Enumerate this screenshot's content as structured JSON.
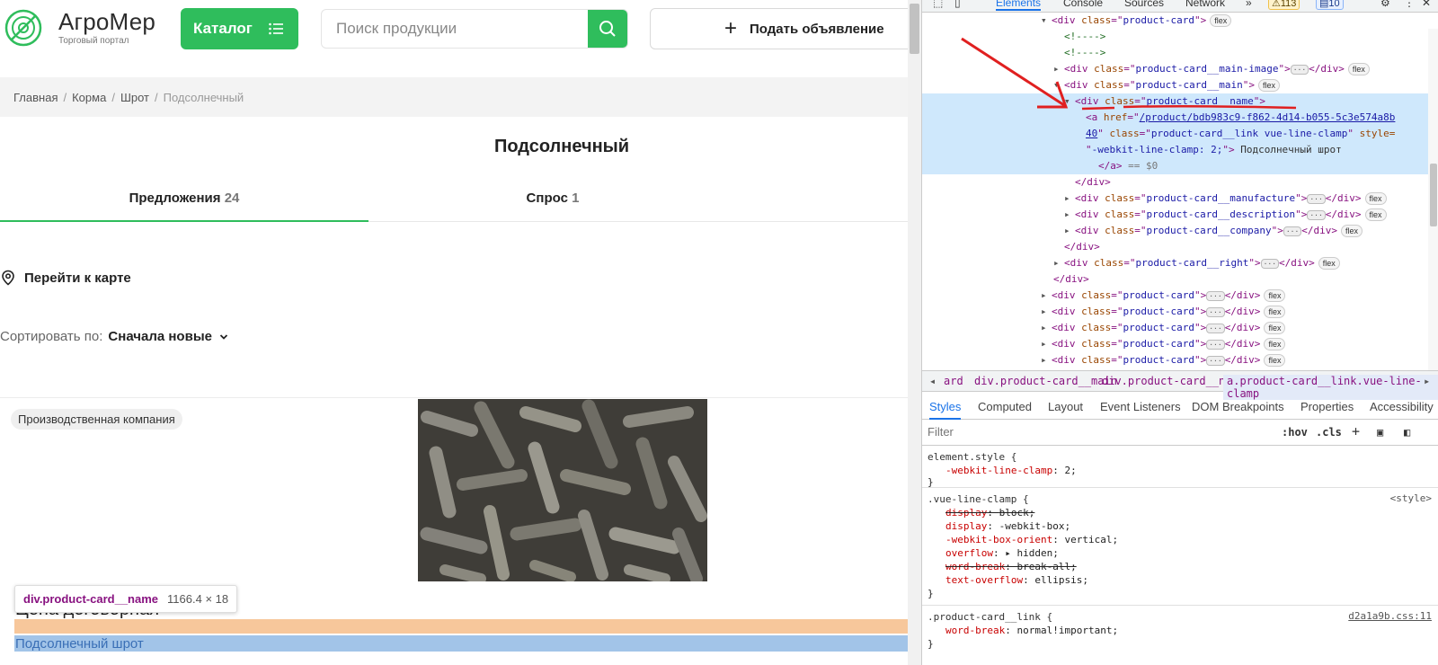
{
  "site": {
    "logo_name": "АгроМер",
    "logo_sub": "Торговый портал",
    "catalog_label": "Каталог",
    "search_placeholder": "Поиск продукции",
    "post_ad_label": "Подать объявление",
    "breadcrumbs": [
      "Главная",
      "Корма",
      "Шрот",
      "Подсолнечный"
    ],
    "page_title": "Подсолнечный",
    "tabs": [
      {
        "label": "Предложения",
        "count": "24"
      },
      {
        "label": "Спрос",
        "count": "1"
      }
    ],
    "map_link": "Перейти к карте",
    "sort_label": "Сортировать по:",
    "sort_value": "Сначала новые",
    "card": {
      "company_type": "Производственная компания",
      "price": "Цена договорная",
      "product_name": "Подсолнечный шрот"
    },
    "tooltip": {
      "selector": "div.product-card__name",
      "size": "1166.4 × 18"
    },
    "accent_color": "#2fbd5c"
  },
  "devtools": {
    "tabs": [
      "Elements",
      "Console",
      "Sources",
      "Network"
    ],
    "warn_count": "113",
    "info_count": "10",
    "dom_lines": [
      {
        "text_tag": "<div ",
        "attr": "class",
        "val": "product-card",
        "end": ">",
        "badge": "flex"
      },
      {
        "comment": "<!---->"
      },
      {
        "comment": "<!---->"
      },
      {
        "text_tag": "<div ",
        "attr": "class",
        "val": "product-card__main-image",
        "end": ">",
        "collapsed": "</div>",
        "badge": "flex"
      },
      {
        "text_tag": "<div ",
        "attr": "class",
        "val": "product-card__main",
        "end": ">",
        "badge": "flex"
      },
      {
        "text_tag": "<div ",
        "attr": "class",
        "val": "product-card__name",
        "end": ">"
      },
      {
        "a_href": "/product/bdb983c9-f862-4d14-b055-5c3e574a8b",
        "a_class": "product-card__link vue-line-clamp",
        "a_style_attr": "style=",
        "a_style": "-webkit-line-clamp: 2;",
        "a_text": "Подсолнечный шрот",
        "href_tail": "40",
        "a_close": "</a>",
        "eq": "== $0"
      },
      {
        "close": "</div>"
      },
      {
        "text_tag": "<div ",
        "attr": "class",
        "val": "product-card__manufacture",
        "end": ">",
        "collapsed": "</div>",
        "badge": "flex"
      },
      {
        "text_tag": "<div ",
        "attr": "class",
        "val": "product-card__description",
        "end": ">",
        "collapsed": "</div>",
        "badge": "flex"
      },
      {
        "text_tag": "<div ",
        "attr": "class",
        "val": "product-card__company",
        "end": ">",
        "collapsed": "</div>",
        "badge": "flex"
      },
      {
        "close": "</div>"
      },
      {
        "text_tag": "<div ",
        "attr": "class",
        "val": "product-card__right",
        "end": ">",
        "collapsed": "</div>",
        "badge": "flex"
      },
      {
        "close": "</div>"
      },
      {
        "text_tag": "<div ",
        "attr": "class",
        "val": "product-card",
        "end": ">",
        "collapsed": "</div>",
        "badge": "flex"
      },
      {
        "text_tag": "<div ",
        "attr": "class",
        "val": "product-card",
        "end": ">",
        "collapsed": "</div>",
        "badge": "flex"
      },
      {
        "text_tag": "<div ",
        "attr": "class",
        "val": "product-card",
        "end": ">",
        "collapsed": "</div>",
        "badge": "flex"
      },
      {
        "text_tag": "<div ",
        "attr": "class",
        "val": "product-card",
        "end": ">",
        "collapsed": "</div>",
        "badge": "flex"
      },
      {
        "text_tag": "<div ",
        "attr": "class",
        "val": "product-card",
        "end": ">",
        "collapsed": "</div>",
        "badge": "flex"
      }
    ],
    "breadcrumb_path": [
      "ard",
      "div.product-card__main",
      "div.product-card__name",
      "a.product-card__link.vue-line-clamp"
    ],
    "subtabs": [
      "Styles",
      "Computed",
      "Layout",
      "Event Listeners",
      "DOM Breakpoints",
      "Properties",
      "Accessibility"
    ],
    "filter_placeholder": "Filter",
    "hov": ":hov",
    "cls": ".cls",
    "rules": [
      {
        "selector": "element.style {",
        "props": [
          {
            "p": "-webkit-line-clamp",
            "v": "2;"
          }
        ]
      },
      {
        "selector": ".vue-line-clamp {",
        "source": "<style>",
        "props": [
          {
            "p": "display",
            "v": "block;",
            "strike": true
          },
          {
            "p": "display",
            "v": "-webkit-box;"
          },
          {
            "p": "-webkit-box-orient",
            "v": "vertical;"
          },
          {
            "p": "overflow",
            "v": "hidden;",
            "expand": true
          },
          {
            "p": "word-break",
            "v": "break-all;",
            "strike": true
          },
          {
            "p": "text-overflow",
            "v": "ellipsis;"
          }
        ]
      },
      {
        "selector": ".product-card__link {",
        "source": "d2a1a9b.css:11",
        "props": [
          {
            "p": "word-break",
            "v": "normal!important;"
          }
        ]
      }
    ]
  }
}
